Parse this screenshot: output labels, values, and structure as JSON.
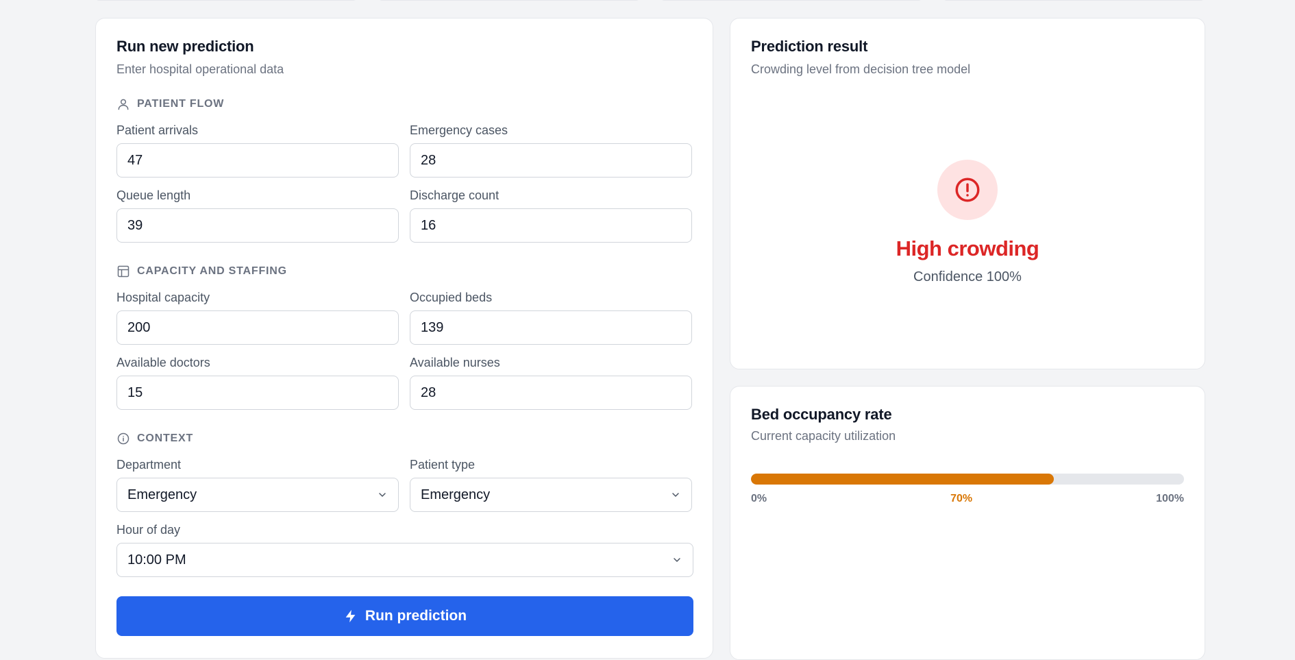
{
  "form": {
    "title": "Run new prediction",
    "subtitle": "Enter hospital operational data",
    "sections": {
      "patient_flow": "PATIENT FLOW",
      "capacity": "CAPACITY AND STAFFING",
      "context": "CONTEXT"
    },
    "fields": {
      "patient_arrivals": {
        "label": "Patient arrivals",
        "value": "47"
      },
      "emergency_cases": {
        "label": "Emergency cases",
        "value": "28"
      },
      "queue_length": {
        "label": "Queue length",
        "value": "39"
      },
      "discharge_count": {
        "label": "Discharge count",
        "value": "16"
      },
      "hospital_capacity": {
        "label": "Hospital capacity",
        "value": "200"
      },
      "occupied_beds": {
        "label": "Occupied beds",
        "value": "139"
      },
      "available_doctors": {
        "label": "Available doctors",
        "value": "15"
      },
      "available_nurses": {
        "label": "Available nurses",
        "value": "28"
      },
      "department": {
        "label": "Department",
        "value": "Emergency"
      },
      "patient_type": {
        "label": "Patient type",
        "value": "Emergency"
      },
      "hour_of_day": {
        "label": "Hour of day",
        "value": "10:00 PM"
      }
    },
    "run_label": "Run prediction",
    "icons": {
      "patient_flow": "user-icon",
      "capacity": "layout-icon",
      "context": "info-icon",
      "run": "bolt-icon",
      "select": "chevron-down-icon"
    }
  },
  "result": {
    "title": "Prediction result",
    "subtitle": "Crowding level from decision tree model",
    "level": "High crowding",
    "confidence": "Confidence 100%",
    "icon": "alert-circle-icon",
    "color": "#dc2626"
  },
  "occupancy": {
    "title": "Bed occupancy rate",
    "subtitle": "Current capacity utilization",
    "percent": 70,
    "label_min": "0%",
    "label_value": "70%",
    "label_max": "100%",
    "color": "#d97706"
  },
  "colors": {
    "primary": "#2563eb",
    "danger": "#dc2626",
    "warning": "#d97706",
    "background": "#f3f4f6"
  }
}
